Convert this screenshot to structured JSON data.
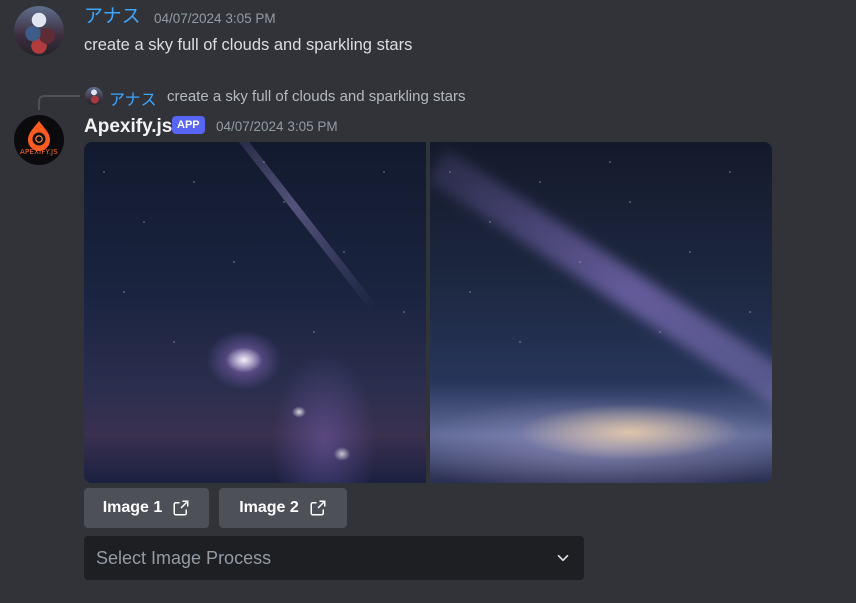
{
  "message1": {
    "username": "アナス",
    "timestamp": "04/07/2024 3:05 PM",
    "text": "create a sky full of clouds and sparkling stars"
  },
  "reply_ref": {
    "username": "アナス",
    "text": "create a sky full of clouds and sparkling stars"
  },
  "message2": {
    "bot_name": "Apexify.js",
    "badge": "APP",
    "timestamp": "04/07/2024 3:05 PM",
    "avatar_label": "APEXIFY.JS"
  },
  "buttons": [
    {
      "label": "Image 1",
      "icon": "external-link-icon"
    },
    {
      "label": "Image 2",
      "icon": "external-link-icon"
    }
  ],
  "select": {
    "placeholder": "Select Image Process",
    "icon": "chevron-down-icon"
  },
  "colors": {
    "background": "#313338",
    "username": "#3ea6ff",
    "app_badge": "#5865f2",
    "button": "#4e5058",
    "select_bg": "#1e1f22"
  }
}
